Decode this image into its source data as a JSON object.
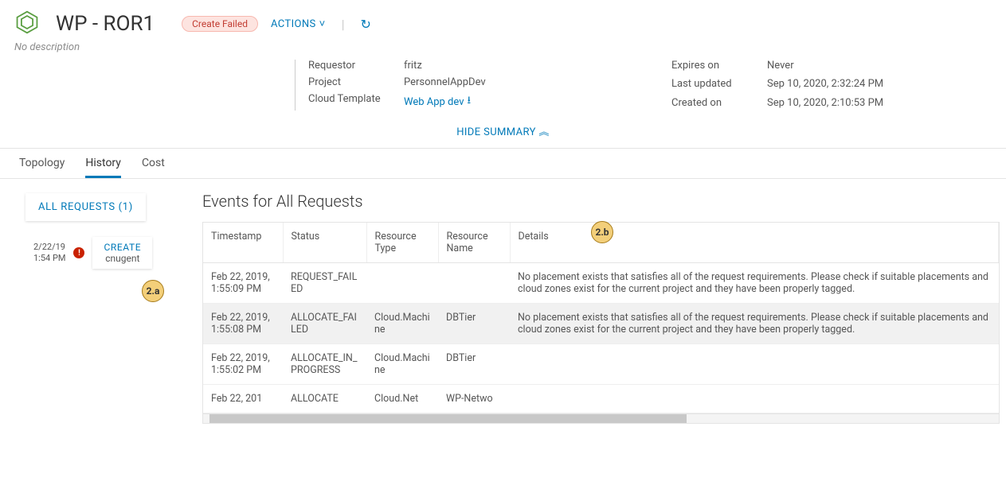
{
  "header": {
    "title": "WP - ROR1",
    "status": "Create Failed",
    "actions_label": "ACTIONS",
    "no_description": "No description"
  },
  "details_left": {
    "requestor_lbl": "Requestor",
    "requestor_val": "fritz",
    "project_lbl": "Project",
    "project_val": "PersonnelAppDev",
    "template_lbl": "Cloud Template",
    "template_val": "Web App dev"
  },
  "details_right": {
    "expires_lbl": "Expires on",
    "expires_val": "Never",
    "updated_lbl": "Last updated",
    "updated_val": "Sep 10, 2020, 2:32:24 PM",
    "created_lbl": "Created on",
    "created_val": "Sep 10, 2020, 2:10:53 PM"
  },
  "summary_toggle": "HIDE SUMMARY",
  "tabs": {
    "topology": "Topology",
    "history": "History",
    "cost": "Cost"
  },
  "sidebar": {
    "all_requests": "ALL REQUESTS (1)",
    "item": {
      "date": "2/22/19",
      "time": "1:54 PM",
      "action": "CREATE",
      "user": "cnugent"
    }
  },
  "events": {
    "title": "Events for All Requests",
    "columns": {
      "ts": "Timestamp",
      "status": "Status",
      "rtype": "Resource Type",
      "rname": "Resource Name",
      "details": "Details"
    },
    "rows": [
      {
        "ts": "Feb 22, 2019, 1:55:09 PM",
        "status": "REQUEST_FAILED",
        "rtype": "",
        "rname": "",
        "details": "No placement exists that satisfies all of the request requirements. Please check if suitable placements and cloud zones exist for the current project and they have been properly tagged."
      },
      {
        "ts": "Feb 22, 2019, 1:55:08 PM",
        "status": "ALLOCATE_FAILED",
        "rtype": "Cloud.Machine",
        "rname": "DBTier",
        "details": "No placement exists that satisfies all of the request requirements. Please check if suitable placements and cloud zones exist for the current project and they have been properly tagged."
      },
      {
        "ts": "Feb 22, 2019, 1:55:02 PM",
        "status": "ALLOCATE_IN_PROGRESS",
        "rtype": "Cloud.Machine",
        "rname": "DBTier",
        "details": ""
      },
      {
        "ts": "Feb 22, 201",
        "status": "ALLOCATE",
        "rtype": "Cloud.Net",
        "rname": "WP-Netwo",
        "details": ""
      }
    ]
  },
  "callouts": {
    "a": "2.a",
    "b": "2.b"
  }
}
